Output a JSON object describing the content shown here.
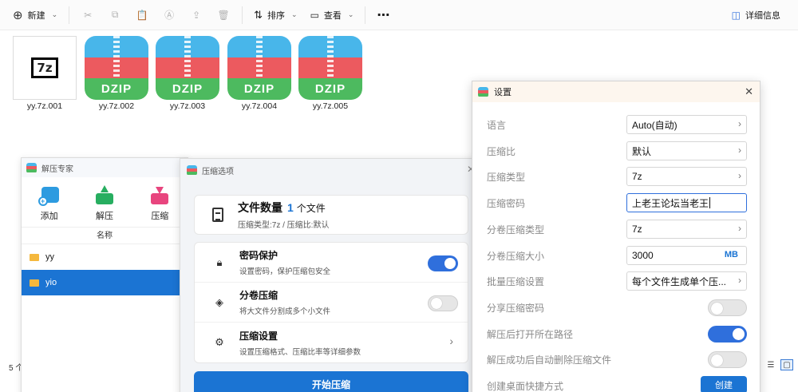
{
  "toolbar": {
    "new_label": "新建",
    "sort_label": "排序",
    "view_label": "查看",
    "details_label": "详细信息"
  },
  "files": [
    {
      "name": "yy.7z.001",
      "icon": "7z-icon"
    },
    {
      "name": "yy.7z.002",
      "icon": "dzip-icon",
      "badge": "DZIP"
    },
    {
      "name": "yy.7z.003",
      "icon": "dzip-icon",
      "badge": "DZIP"
    },
    {
      "name": "yy.7z.004",
      "icon": "dzip-icon",
      "badge": "DZIP"
    },
    {
      "name": "yy.7z.005",
      "icon": "dzip-icon",
      "badge": "DZIP"
    }
  ],
  "thumb_7z_logo": "7z",
  "status": {
    "items_count": "5 个"
  },
  "expert": {
    "title": "解压专家",
    "tools": [
      "添加",
      "解压",
      "压缩"
    ],
    "column_name": "名称",
    "rows": [
      "yy",
      "yio"
    ]
  },
  "options": {
    "title": "压缩选项",
    "count_label": "文件数量",
    "count_value": "1",
    "count_unit": "个文件",
    "count_sub": "压缩类型:7z / 压缩比:默认",
    "settings": [
      {
        "title": "密码保护",
        "desc": "设置密码，保护压缩包安全",
        "control": "toggle",
        "on": true
      },
      {
        "title": "分卷压缩",
        "desc": "将大文件分割成多个小文件",
        "control": "toggle",
        "on": false
      },
      {
        "title": "压缩设置",
        "desc": "设置压缩格式、压缩比率等详细参数",
        "control": "chevron"
      }
    ],
    "start_label": "开始压缩"
  },
  "settings": {
    "title": "设置",
    "rows": [
      {
        "label": "语言",
        "value": "Auto(自动)"
      },
      {
        "label": "压缩比",
        "value": "默认"
      },
      {
        "label": "压缩类型",
        "value": "7z"
      },
      {
        "label": "压缩密码",
        "value": "上老王论坛当老王"
      },
      {
        "label": "分卷压缩类型",
        "value": "7z"
      },
      {
        "label": "分卷压缩大小",
        "value": "3000",
        "unit": "MB"
      },
      {
        "label": "批量压缩设置",
        "value": "每个文件生成单个压..."
      },
      {
        "label": "分享压缩密码",
        "toggle": false
      },
      {
        "label": "解压后打开所在路径",
        "toggle": true
      },
      {
        "label": "解压成功后自动删除压缩文件",
        "toggle": false
      },
      {
        "label": "创建桌面快捷方式",
        "button": "创建"
      }
    ]
  },
  "colors": {
    "accent": "#1b74d3",
    "toggle_on": "#2f6fdc",
    "dzip_blue": "#48b6ea",
    "dzip_red": "#ec5a5f",
    "dzip_green": "#4dba5f"
  }
}
